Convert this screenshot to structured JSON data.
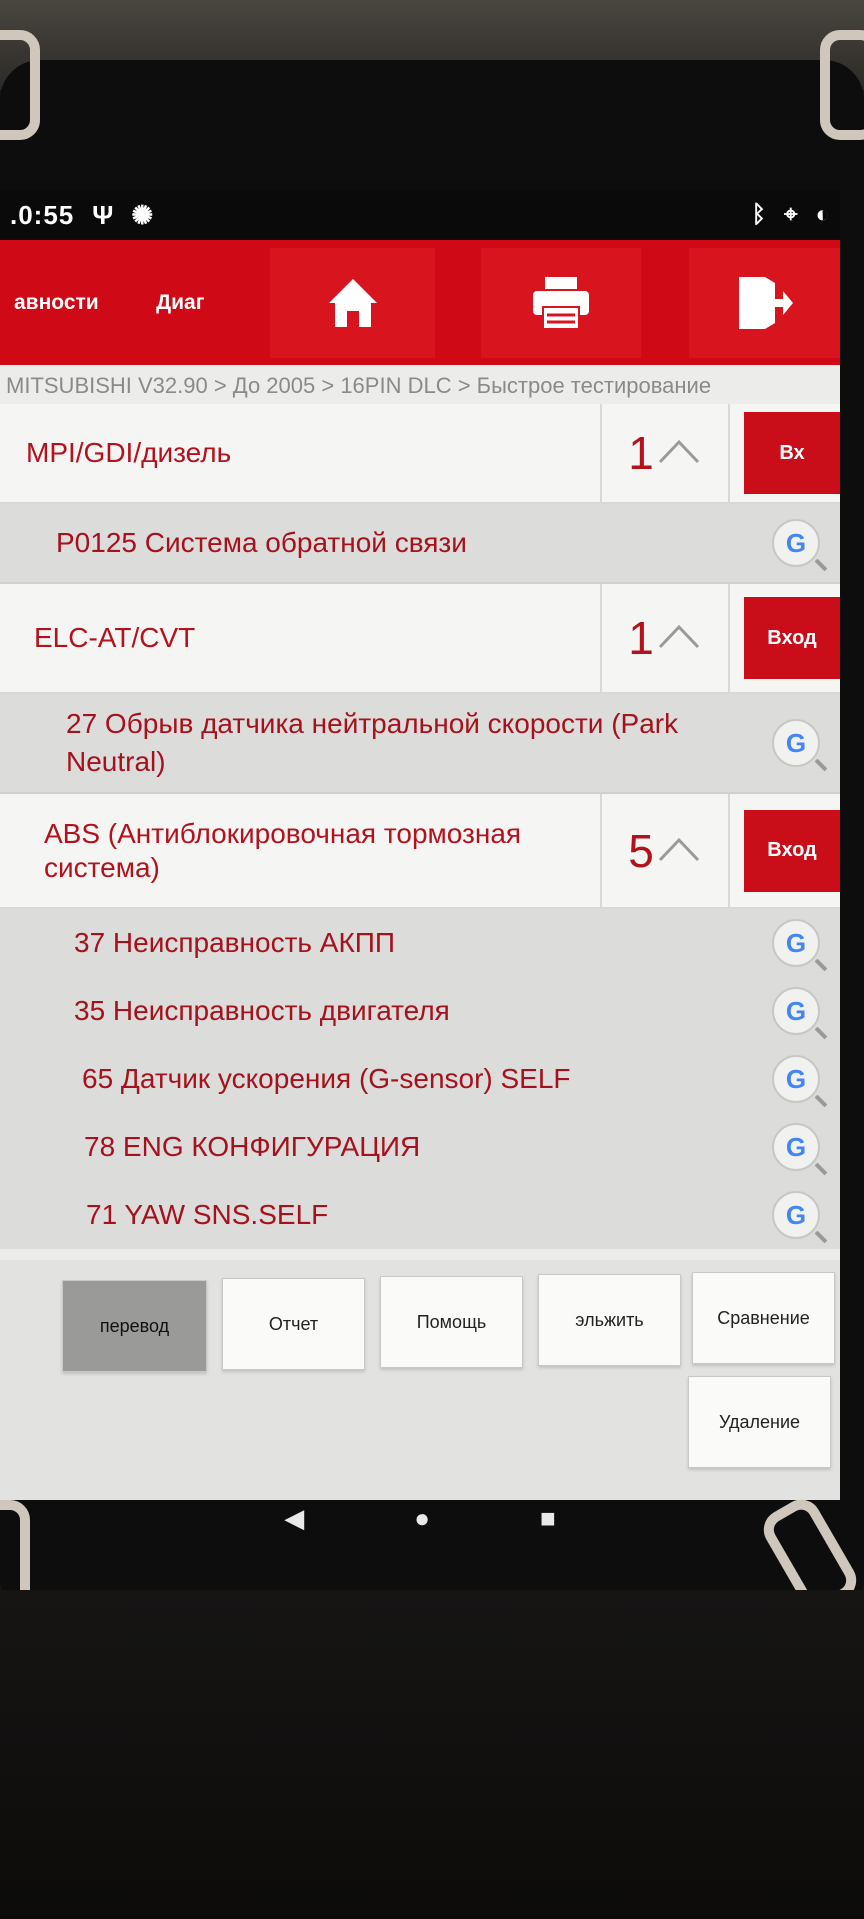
{
  "status": {
    "time": ".0:55",
    "left_icons": [
      "usb-icon",
      "bug-icon"
    ],
    "right_icons": [
      "bluetooth-icon",
      "location-icon",
      "vibrate-icon"
    ]
  },
  "toolbar": {
    "tab1_label": "авности",
    "tab2_label": "Диаг",
    "home_icon": "home-icon",
    "print_icon": "printer-icon",
    "exit_icon": "exit-icon"
  },
  "breadcrumb": "MITSUBISHI V32.90 > До 2005  > 16PIN DLC > Быстрое тестирование",
  "systems": [
    {
      "name": "MPI/GDI/дизель",
      "count": "1",
      "enter_label": "Вх",
      "codes": [
        {
          "text": "P0125 Система обратной связи"
        }
      ]
    },
    {
      "name": "ELC-AT/CVT",
      "count": "1",
      "enter_label": "Вход",
      "codes": [
        {
          "text": "27 Обрыв датчика нейтральной скорости (Park Neutral)"
        }
      ]
    },
    {
      "name": "ABS (Антиблокировочная тормозная система)",
      "count": "5",
      "enter_label": "Вход",
      "codes": [
        {
          "text": "37 Неисправность АКПП"
        },
        {
          "text": "35 Неисправность двигателя"
        },
        {
          "text": "65 Датчик ускорения (G-sensor) SELF"
        },
        {
          "text": "78 ENG КОНФИГУРАЦИЯ"
        },
        {
          "text": "71 YAW SNS.SELF"
        }
      ]
    }
  ],
  "bottom_buttons": {
    "translate": "перевод",
    "report": "Отчет",
    "help": "Помощь",
    "save": "эльжить",
    "compare": "Сравнение",
    "delete": "Удаление"
  },
  "colors": {
    "brand_red": "#cf0a16",
    "text_red": "#b3121d"
  }
}
